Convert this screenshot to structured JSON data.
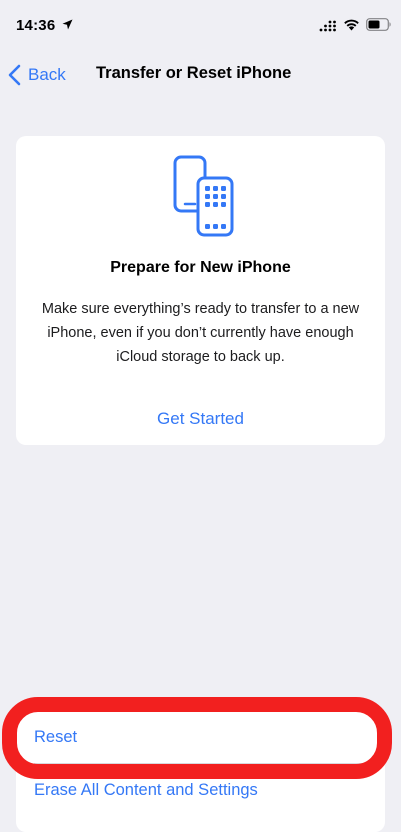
{
  "status_bar": {
    "time": "14:36",
    "icons": [
      "location-arrow-icon",
      "cellular-signal-icon",
      "wifi-icon",
      "battery-icon"
    ]
  },
  "nav": {
    "back_label": "Back",
    "title": "Transfer or Reset iPhone"
  },
  "prepare_card": {
    "icon": "phones-transfer-icon",
    "title": "Prepare for New iPhone",
    "description": "Make sure everything’s ready to transfer to a new iPhone, even if you don’t currently have enough iCloud storage to back up.",
    "action_label": "Get Started"
  },
  "reset_options": [
    {
      "label": "Reset"
    },
    {
      "label": "Erase All Content and Settings"
    }
  ],
  "colors": {
    "background": "#efeff4",
    "card": "#ffffff",
    "accent": "#3478f6",
    "highlight": "#f2201f"
  }
}
